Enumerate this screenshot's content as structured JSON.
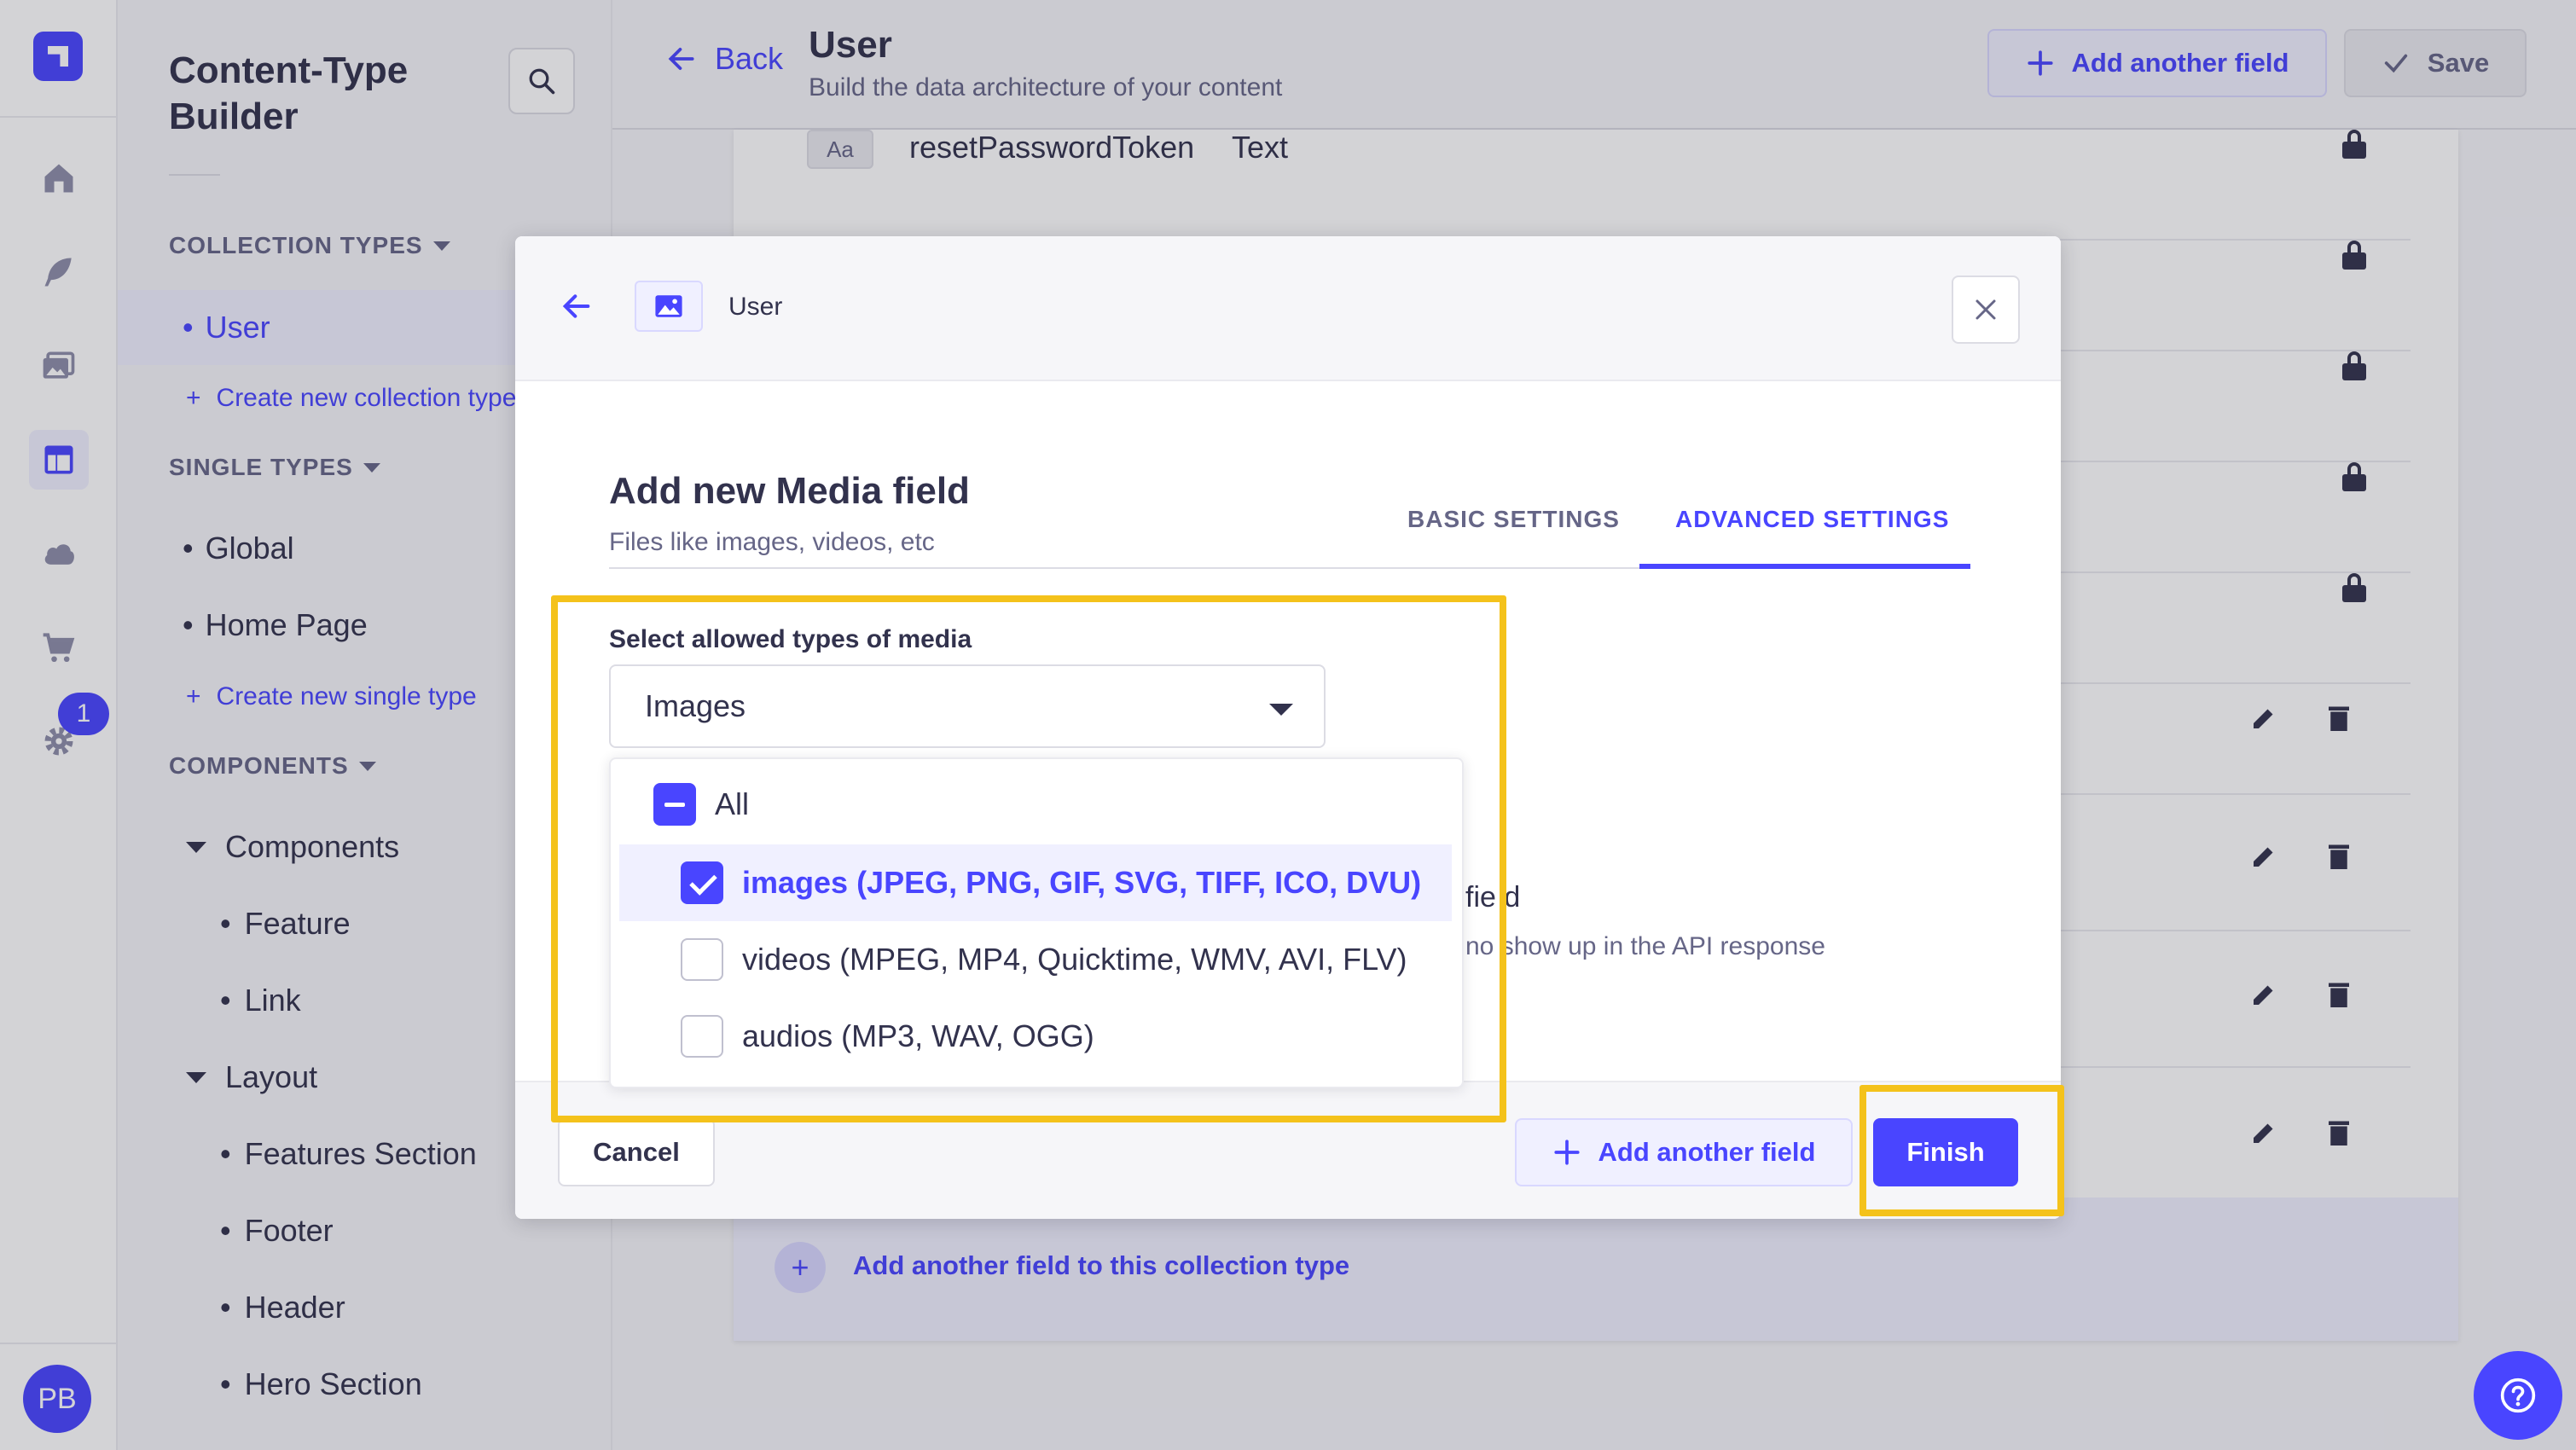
{
  "rail": {
    "logo": "strapi-logo",
    "items": [
      {
        "icon": "home-icon",
        "active": false
      },
      {
        "icon": "feather-icon",
        "active": false
      },
      {
        "icon": "media-library-icon",
        "active": false
      },
      {
        "icon": "layout-icon",
        "active": true
      },
      {
        "icon": "cloud-icon",
        "active": false
      },
      {
        "icon": "cart-icon",
        "active": false
      },
      {
        "icon": "settings-icon",
        "active": false
      }
    ],
    "settings_badge": "1",
    "avatar_initials": "PB"
  },
  "sidebar": {
    "title": "Content-Type Builder",
    "collection_types_label": "COLLECTION TYPES",
    "collection_types": [
      "User"
    ],
    "create_collection_type": "Create new collection type",
    "single_types_label": "SINGLE TYPES",
    "single_types": [
      "Global",
      "Home Page"
    ],
    "create_single_type": "Create new single type",
    "components_label": "COMPONENTS",
    "component_groups": [
      {
        "name": "Components",
        "items": [
          "Feature",
          "Link"
        ]
      },
      {
        "name": "Layout",
        "items": [
          "Features Section",
          "Footer",
          "Header",
          "Hero Section"
        ]
      }
    ]
  },
  "header": {
    "back_label": "Back",
    "title": "User",
    "subtitle": "Build the data architecture of your content",
    "add_field_label": "Add another field",
    "save_label": "Save"
  },
  "field_list": {
    "first_row": {
      "icon": "Aa",
      "name": "resetPasswordToken",
      "type": "Text"
    },
    "add_field_to_collection": "Add another field to this collection type"
  },
  "modal": {
    "breadcrumb": "User",
    "title": "Add new Media field",
    "subtitle": "Files like images, videos, etc",
    "tabs": [
      "BASIC SETTINGS",
      "ADVANCED SETTINGS"
    ],
    "active_tab": "ADVANCED SETTINGS",
    "allowed_types_label": "Select allowed types of media",
    "allowed_types_value": "Images",
    "hidden_field_label_partial": "fie d",
    "hidden_field_desc_partial": "no  show up in the API response",
    "cancel_label": "Cancel",
    "add_another_label": "Add another field",
    "finish_label": "Finish"
  },
  "dropdown": {
    "all_label": "All",
    "all_state": "indeterminate",
    "options": [
      {
        "label": "images (JPEG, PNG, GIF, SVG, TIFF, ICO, DVU)",
        "checked": true
      },
      {
        "label": "videos (MPEG, MP4, Quicktime, WMV, AVI, FLV)",
        "checked": false
      },
      {
        "label": "audios (MP3, WAV, OGG)",
        "checked": false
      }
    ]
  },
  "colors": {
    "primary": "#4945ff",
    "primary_light": "#f0f0ff",
    "highlight": "#f4c21b",
    "text": "#32324d",
    "muted": "#666687"
  }
}
